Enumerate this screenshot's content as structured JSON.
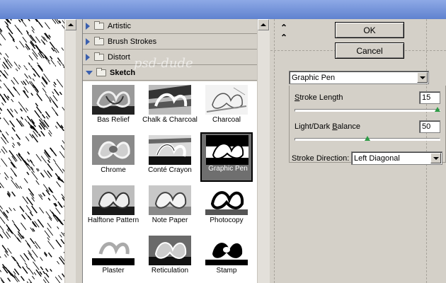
{
  "window": {
    "title_bar_color": "#6f8fd8"
  },
  "watermark": {
    "text": "psd-dude"
  },
  "categories": [
    {
      "label": "Artistic",
      "expanded": false
    },
    {
      "label": "Brush Strokes",
      "expanded": false
    },
    {
      "label": "Distort",
      "expanded": false
    },
    {
      "label": "Sketch",
      "expanded": true
    }
  ],
  "thumbnails": [
    {
      "label": "Bas Relief",
      "selected": false
    },
    {
      "label": "Chalk & Charcoal",
      "selected": false
    },
    {
      "label": "Charcoal",
      "selected": false
    },
    {
      "label": "Chrome",
      "selected": false
    },
    {
      "label": "Conté Crayon",
      "selected": false
    },
    {
      "label": "Graphic Pen",
      "selected": true
    },
    {
      "label": "Halftone Pattern",
      "selected": false
    },
    {
      "label": "Note Paper",
      "selected": false
    },
    {
      "label": "Photocopy",
      "selected": false
    },
    {
      "label": "Plaster",
      "selected": false
    },
    {
      "label": "Reticulation",
      "selected": false
    },
    {
      "label": "Stamp",
      "selected": false
    }
  ],
  "buttons": {
    "ok": "OK",
    "cancel": "Cancel"
  },
  "filter_select": {
    "value": "Graphic Pen"
  },
  "params": {
    "stroke_length": {
      "label": "Stroke Length",
      "value": "15",
      "min": 1,
      "max": 15,
      "slider_value": 15
    },
    "balance": {
      "label": "Light/Dark Balance",
      "value": "50",
      "min": 0,
      "max": 100,
      "slider_value": 50
    },
    "direction": {
      "label": "Stroke Direction:",
      "value": "Left Diagonal"
    }
  },
  "icons": {
    "collapse": "double-chevron-up-icon",
    "category_arrow": "triangle-right-icon",
    "folder": "folder-icon"
  },
  "colors": {
    "slider_knob": "#2e9b46",
    "panel_bg": "#d4d0c8",
    "selected_thumb_bg": "#6f6f6f"
  }
}
